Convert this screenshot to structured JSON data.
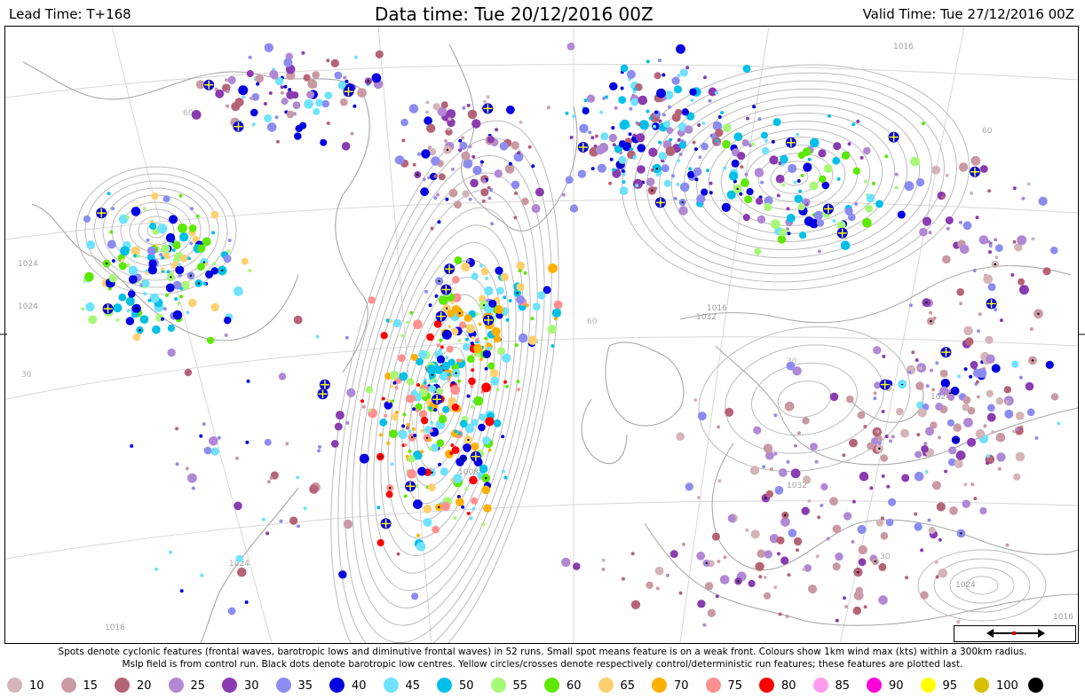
{
  "header": {
    "lead_time": "Lead Time: T+168",
    "data_time": "Data time:  Tue 20/12/2016 00Z",
    "valid_time": "Valid Time: Tue 27/12/2016 00Z"
  },
  "caption": {
    "line1": "Spots denote cyclonic features (frontal waves, barotropic lows and diminutive frontal waves) in 52 runs. Small spot means feature is on a weak front. Colours show 1km wind max (kts) within a 300km radius.",
    "line2": "Mslp field is from control run. Black dots denote barotropic low centres. Yellow circles/crosses denote respectively control/deterministic run features; these features are plotted last."
  },
  "legend": [
    {
      "label": "10",
      "color": "#d4b4b8"
    },
    {
      "label": "15",
      "color": "#c99aa4"
    },
    {
      "label": "20",
      "color": "#b56478"
    },
    {
      "label": "25",
      "color": "#b088d4"
    },
    {
      "label": "30",
      "color": "#8a3cb0"
    },
    {
      "label": "35",
      "color": "#8c8cf0"
    },
    {
      "label": "40",
      "color": "#0000e0"
    },
    {
      "label": "45",
      "color": "#6ee2ff"
    },
    {
      "label": "50",
      "color": "#00c0e8"
    },
    {
      "label": "55",
      "color": "#a8f878"
    },
    {
      "label": "60",
      "color": "#5ce800"
    },
    {
      "label": "65",
      "color": "#ffd070"
    },
    {
      "label": "70",
      "color": "#ffb000"
    },
    {
      "label": "75",
      "color": "#ff9090"
    },
    {
      "label": "80",
      "color": "#ff0000"
    },
    {
      "label": "85",
      "color": "#ff9cf0"
    },
    {
      "label": "90",
      "color": "#ff00d8"
    },
    {
      "label": "95",
      "color": "#ffff00"
    },
    {
      "label": "100",
      "color": "#d8c000"
    },
    {
      "label": "",
      "color": "#000000"
    }
  ],
  "isobar_labels": [
    "1024",
    "1024",
    "1016",
    "1024",
    "1032",
    "1016",
    "1024",
    "1016",
    "1032",
    "1024",
    "1016",
    "1008"
  ],
  "grid_labels": [
    "30",
    "30",
    "30",
    "60",
    "60",
    "60"
  ]
}
